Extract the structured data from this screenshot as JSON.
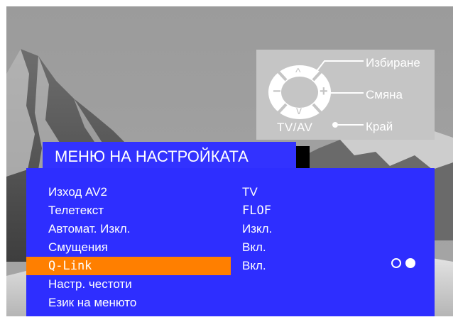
{
  "help": {
    "select_label": "Избиране",
    "change_label": "Смяна",
    "exit_label": "Край",
    "tvav_label": "TV/AV",
    "up_symbol": "^",
    "down_symbol": "v",
    "minus_symbol": "−",
    "plus_symbol": "+"
  },
  "menu": {
    "title": "МЕНЮ НА НАСТРОЙКАТА",
    "items": [
      {
        "label": "Изход AV2",
        "value": "TV",
        "selected": false
      },
      {
        "label": "Телетекст",
        "value": "FLOF",
        "selected": false
      },
      {
        "label": "Автомат. Изкл.",
        "value": "Изкл.",
        "selected": false
      },
      {
        "label": "Смущения",
        "value": "Вкл.",
        "selected": false
      },
      {
        "label": "Q-Link",
        "value": "Вкл.",
        "selected": true
      },
      {
        "label": "Настр. честоти",
        "value": "",
        "selected": false
      },
      {
        "label": "Език на менюто",
        "value": "",
        "selected": false
      }
    ]
  },
  "colors": {
    "menu_background": "#2e2eff",
    "title_background": "#3232ff",
    "selection_highlight": "#ff7f00",
    "help_panel": "#c5c5c5",
    "text": "#ffffff"
  }
}
